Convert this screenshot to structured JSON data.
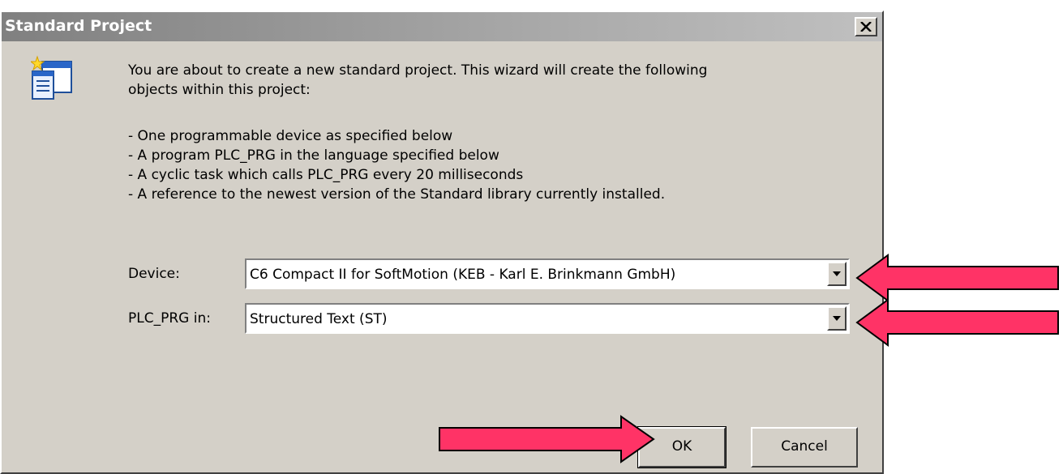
{
  "dialog": {
    "title": "Standard Project",
    "intro_line1": "You are about to create a new standard project. This wizard will create the following",
    "intro_line2": "objects within this project:",
    "bullets": [
      "- One programmable device as specified below",
      "- A program PLC_PRG in the language specified below",
      "- A cyclic task which calls PLC_PRG every 20 milliseconds",
      "- A reference to the newest version of the Standard library currently installed."
    ],
    "device_label": "Device:",
    "device_value": "C6 Compact II for SoftMotion (KEB - Karl E. Brinkmann GmbH)",
    "plc_label": "PLC_PRG in:",
    "plc_value": "Structured Text (ST)",
    "ok_label": "OK",
    "cancel_label": "Cancel"
  },
  "annotations": {
    "arrow_color": "#ff3366"
  },
  "icons": {
    "close": "close-icon",
    "wizard": "wizard-icon",
    "dropdown": "chevron-down-icon",
    "callout": "red-arrow-icon"
  }
}
